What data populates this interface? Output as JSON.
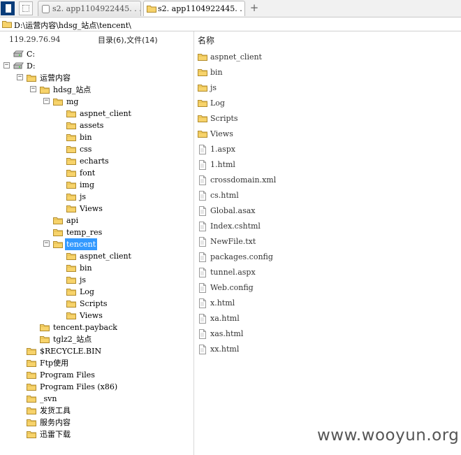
{
  "tabs": [
    {
      "label": "s2. app1104922445. . . . ."
    },
    {
      "label": "s2. app1104922445. . . . ."
    }
  ],
  "path": "D:\\运营内容\\hdsg_站点\\tencent\\",
  "left_header": {
    "ip": "119.29.76.94",
    "counts": "目录(6),文件(14)"
  },
  "tree": [
    {
      "label": "C:",
      "type": "drive"
    },
    {
      "label": "D:",
      "type": "drive",
      "toggle": "−"
    },
    {
      "label": "运营内容",
      "type": "folder",
      "toggle": "−"
    },
    {
      "label": "hdsg_站点",
      "type": "folder",
      "toggle": "−"
    },
    {
      "label": "mg",
      "type": "folder",
      "toggle": "−"
    },
    {
      "label": "aspnet_client",
      "type": "folder"
    },
    {
      "label": "assets",
      "type": "folder"
    },
    {
      "label": "bin",
      "type": "folder"
    },
    {
      "label": "css",
      "type": "folder"
    },
    {
      "label": "echarts",
      "type": "folder"
    },
    {
      "label": "font",
      "type": "folder"
    },
    {
      "label": "img",
      "type": "folder"
    },
    {
      "label": "js",
      "type": "folder"
    },
    {
      "label": "Views",
      "type": "folder"
    },
    {
      "label": "api",
      "type": "folder"
    },
    {
      "label": "temp_res",
      "type": "folder"
    },
    {
      "label": "tencent",
      "type": "folder",
      "toggle": "−",
      "selected": true
    },
    {
      "label": "aspnet_client",
      "type": "folder"
    },
    {
      "label": "bin",
      "type": "folder"
    },
    {
      "label": "js",
      "type": "folder"
    },
    {
      "label": "Log",
      "type": "folder"
    },
    {
      "label": "Scripts",
      "type": "folder"
    },
    {
      "label": "Views",
      "type": "folder"
    },
    {
      "label": "tencent.payback",
      "type": "folder"
    },
    {
      "label": "tglz2_站点",
      "type": "folder"
    },
    {
      "label": "$RECYCLE.BIN",
      "type": "folder"
    },
    {
      "label": "Ftp使用",
      "type": "folder"
    },
    {
      "label": "Program Files",
      "type": "folder"
    },
    {
      "label": "Program Files (x86)",
      "type": "folder"
    },
    {
      "label": "_svn",
      "type": "folder"
    },
    {
      "label": "发货工具",
      "type": "folder"
    },
    {
      "label": "服务内容",
      "type": "folder"
    },
    {
      "label": "迅雷下载",
      "type": "folder"
    }
  ],
  "right_header": "名称",
  "files": [
    {
      "name": "aspnet_client",
      "type": "folder"
    },
    {
      "name": "bin",
      "type": "folder"
    },
    {
      "name": "js",
      "type": "folder"
    },
    {
      "name": "Log",
      "type": "folder"
    },
    {
      "name": "Scripts",
      "type": "folder"
    },
    {
      "name": "Views",
      "type": "folder"
    },
    {
      "name": "1.aspx",
      "type": "file"
    },
    {
      "name": "1.html",
      "type": "file"
    },
    {
      "name": "crossdomain.xml",
      "type": "file"
    },
    {
      "name": "cs.html",
      "type": "file"
    },
    {
      "name": "Global.asax",
      "type": "file"
    },
    {
      "name": "Index.cshtml",
      "type": "file"
    },
    {
      "name": "NewFile.txt",
      "type": "file"
    },
    {
      "name": "packages.config",
      "type": "file"
    },
    {
      "name": "tunnel.aspx",
      "type": "file"
    },
    {
      "name": "Web.config",
      "type": "file"
    },
    {
      "name": "x.html",
      "type": "file"
    },
    {
      "name": "xa.html",
      "type": "file"
    },
    {
      "name": "xas.html",
      "type": "file"
    },
    {
      "name": "xx.html",
      "type": "file"
    }
  ],
  "watermark": "www.wooyun.org",
  "colors": {
    "folder": "#f7d36b",
    "selection": "#3399ff",
    "accent": "#0a3d7a"
  }
}
